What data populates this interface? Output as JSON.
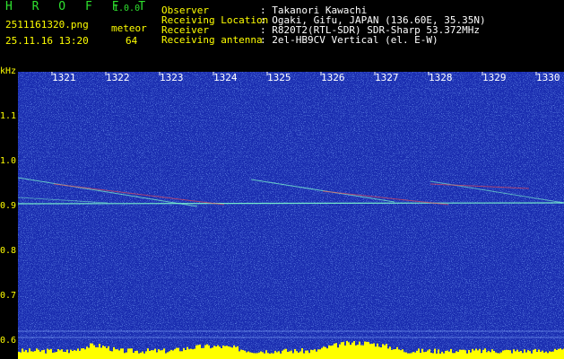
{
  "header": {
    "app_name": "H R O F F T",
    "version": "1.0.0",
    "filename": "2511161320.png",
    "date_time": "25.11.16 13:20",
    "meteor_label": "meteor",
    "meteor_count": "64"
  },
  "info": {
    "rows": [
      {
        "label": "Observer",
        "value": ": Takanori Kawachi"
      },
      {
        "label": "Receiving Location",
        "value": ": Ogaki, Gifu, JAPAN (136.60E, 35.35N)"
      },
      {
        "label": "Receiver",
        "value": ": R820T2(RTL-SDR) SDR-Sharp 53.372MHz"
      },
      {
        "label": "Receiving antenna",
        "value": ": 2el-HB9CV Vertical (el. E-W)"
      }
    ]
  },
  "axis": {
    "y_unit": "kHz",
    "y_ticks": [
      "1.1",
      "1.0",
      "0.9",
      "0.8",
      "0.7",
      "0.6"
    ],
    "x_ticks": [
      "1321",
      "1322",
      "1323",
      "1324",
      "1325",
      "1326",
      "1327",
      "1328",
      "1329",
      "1330"
    ]
  },
  "colors": {
    "background": "#1a2db0",
    "noise": "#3a74ff",
    "trace": "#7fffd0",
    "hot": "#ff4a4a",
    "level": "#ffff00",
    "text_green": "#2fe22f",
    "text_yellow": "#ffff00"
  }
}
